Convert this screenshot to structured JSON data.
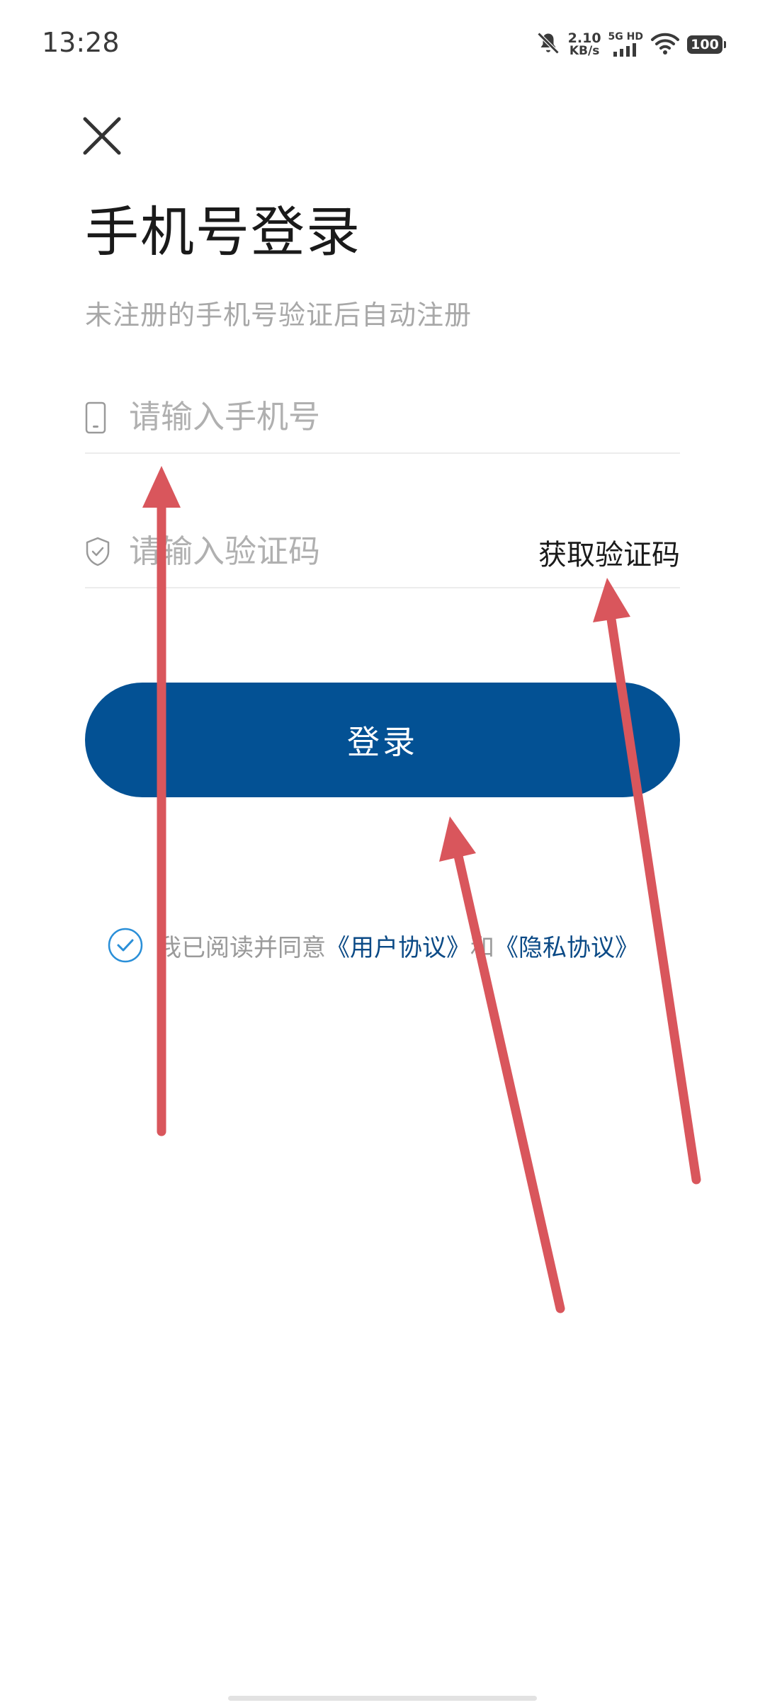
{
  "status_bar": {
    "time": "13:28",
    "net_speed": "2.10",
    "net_unit": "KB/s",
    "signal_label": "5G HD",
    "battery": "100"
  },
  "header": {
    "title": "手机号登录",
    "subtitle": "未注册的手机号验证后自动注册"
  },
  "form": {
    "phone_placeholder": "请输入手机号",
    "code_placeholder": "请输入验证码",
    "get_code_label": "获取验证码",
    "login_label": "登录"
  },
  "agreement": {
    "prefix": "我已阅读并同意",
    "user_agreement": "《用户协议》",
    "joiner": "和",
    "privacy_agreement": "《隐私协议》",
    "checked": true
  },
  "colors": {
    "primary": "#035194",
    "link": "#0b4a86",
    "check": "#2a8fd8",
    "annotation_arrow": "#d9565c",
    "placeholder": "#b0b0b0"
  },
  "icons": {
    "close": "close-icon",
    "phone": "phone-icon",
    "shield": "shield-check-icon",
    "check": "check-circle-icon",
    "mute": "bell-off-icon",
    "signal": "signal-icon",
    "wifi": "wifi-icon",
    "battery": "battery-icon"
  }
}
